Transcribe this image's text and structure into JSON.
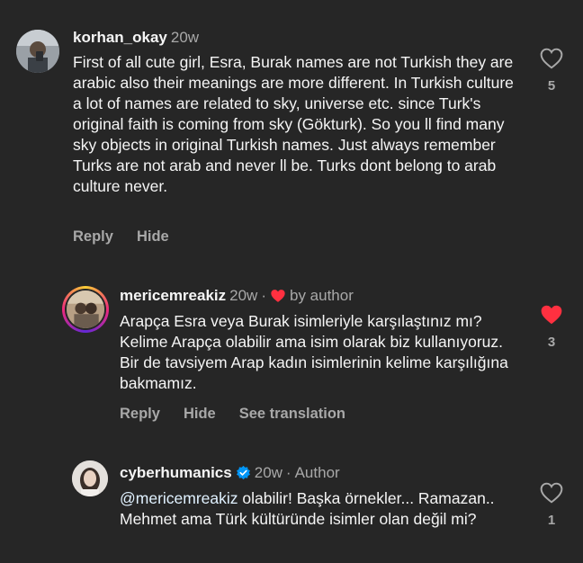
{
  "comments": [
    {
      "username": "korhan_okay",
      "time": "20w",
      "text": "First of all cute girl, Esra, Burak names are not Turkish they are arabic also their meanings are more different. In Turkish culture a lot of names are related to sky, universe etc. since Turk's original faith is coming from sky (Gökturk). So you ll find many sky objects in original Turkish names. Just always remember Turks are not arab and never ll be. Turks dont belong to arab culture never.",
      "actions": [
        "Reply",
        "Hide"
      ],
      "likes": "5",
      "liked": false
    },
    {
      "username": "mericemreakiz",
      "time": "20w",
      "separator": "·",
      "badge": "by author",
      "text": "Arapça Esra veya Burak isimleriyle karşılaştınız mı? Kelime Arapça olabilir ama isim olarak biz kullanıyoruz. Bir de tavsiyem Arap kadın isimlerinin kelime karşılığına bakmamız.",
      "actions": [
        "Reply",
        "Hide",
        "See translation"
      ],
      "likes": "3",
      "liked": true
    },
    {
      "username": "cyberhumanics",
      "time": "20w",
      "separator": "·",
      "badge": "Author",
      "mention": "@mericemreakiz",
      "text": " olabilir! Başka örnekler... Ramazan.. Mehmet ama Türk kültüründe isimler olan değil mi?",
      "likes": "1",
      "liked": false
    }
  ],
  "colors": {
    "background": "#262626",
    "liked_heart": "#ff3040",
    "verified": "#0095f6"
  }
}
